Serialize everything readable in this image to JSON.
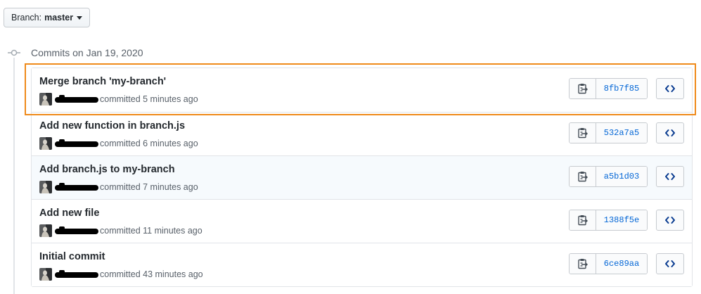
{
  "branch": {
    "prefix": "Branch:",
    "name": "master"
  },
  "commit_group": {
    "title": "Commits on Jan 19, 2020"
  },
  "commits": [
    {
      "title": "Merge branch 'my-branch'",
      "meta": "committed 5 minutes ago",
      "sha": "8fb7f85"
    },
    {
      "title": "Add new function in branch.js",
      "meta": "committed 6 minutes ago",
      "sha": "532a7a5"
    },
    {
      "title": "Add branch.js to my-branch",
      "meta": "committed 7 minutes ago",
      "sha": "a5b1d03"
    },
    {
      "title": "Add new file",
      "meta": "committed 11 minutes ago",
      "sha": "1388f5e"
    },
    {
      "title": "Initial commit",
      "meta": "committed 43 minutes ago",
      "sha": "6ce89aa"
    }
  ],
  "colors": {
    "highlight_outline": "#ef8a1a",
    "link": "#0366d6",
    "highlight_row_bg": "#f6fafd"
  },
  "icons": {
    "branch_caret": "caret-down-icon",
    "timeline_node": "git-commit-icon",
    "copy": "clippy-icon",
    "browse": "code-icon"
  }
}
